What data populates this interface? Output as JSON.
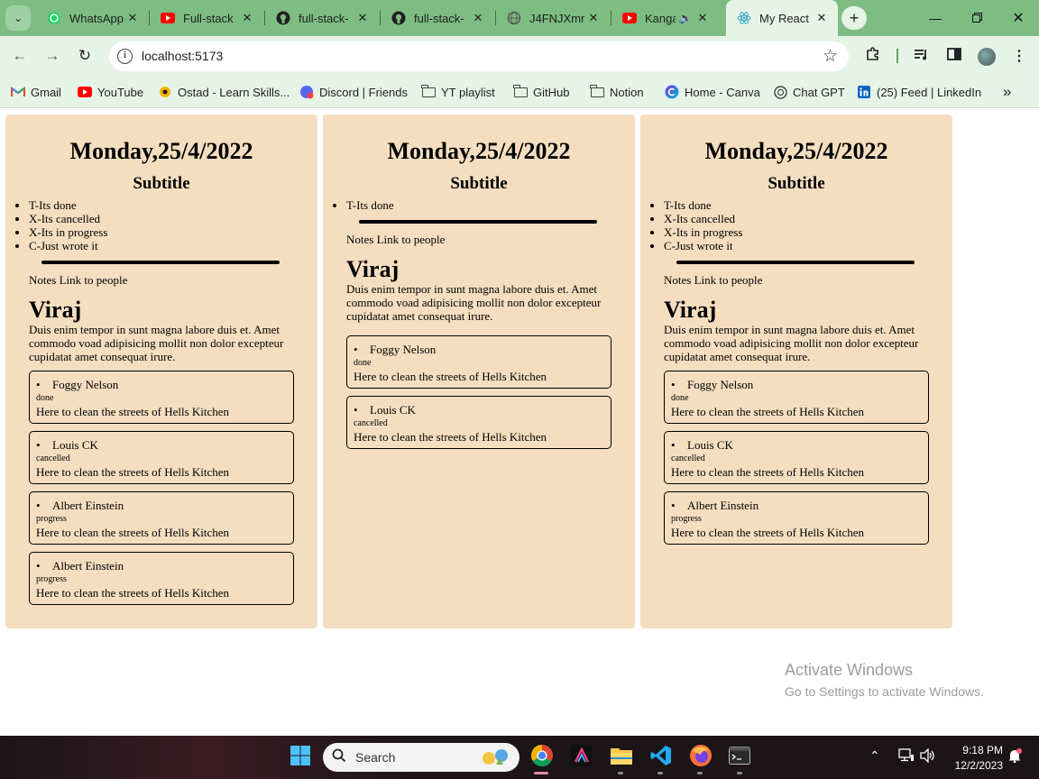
{
  "browser": {
    "tabs": [
      {
        "title": "WhatsApp",
        "icon": "whatsapp-icon",
        "active": false
      },
      {
        "title": "Full-stack",
        "icon": "youtube-icon",
        "active": false
      },
      {
        "title": "full-stack-",
        "icon": "github-icon",
        "active": false
      },
      {
        "title": "full-stack-",
        "icon": "github-icon",
        "active": false
      },
      {
        "title": "J4FNJXmr",
        "icon": "globe-icon",
        "active": false
      },
      {
        "title": "Kanga",
        "icon": "youtube-icon",
        "active": false
      },
      {
        "title": "My React",
        "icon": "react-icon",
        "active": true
      }
    ],
    "close_glyph": "✕",
    "url": "localhost:5173",
    "bookmarks": [
      {
        "label": "Gmail",
        "icon": "gmail-icon"
      },
      {
        "label": "YouTube",
        "icon": "youtube-icon"
      },
      {
        "label": "Ostad - Learn Skills...",
        "icon": "ostad-icon"
      },
      {
        "label": "Discord | Friends",
        "icon": "discord-icon"
      },
      {
        "label": "YT playlist",
        "icon": "folder-icon"
      },
      {
        "label": "GitHub",
        "icon": "folder-icon"
      },
      {
        "label": "Notion",
        "icon": "folder-icon"
      },
      {
        "label": "Home - Canva",
        "icon": "canva-icon"
      },
      {
        "label": "Chat GPT",
        "icon": "chatgpt-icon"
      },
      {
        "label": "(25) Feed | LinkedIn",
        "icon": "linkedin-icon"
      }
    ],
    "bookmarks_overflow": "»"
  },
  "cards": [
    {
      "date": "Monday,25/4/2022",
      "subtitle": "Subtitle",
      "statuses": [
        "T-Its done",
        "X-Its cancelled",
        "X-Its in progress",
        "C-Just wrote it"
      ],
      "notes": "Notes Link to people",
      "person": "Viraj",
      "description": "Duis enim tempor in sunt magna labore duis et. Amet commodo voad adipisicing mollit non dolor excepteur cupidatat amet consequat irure.",
      "people": [
        {
          "name": "Foggy Nelson",
          "status": "done",
          "text": "Here to clean the streets of Hells Kitchen"
        },
        {
          "name": "Louis CK",
          "status": "cancelled",
          "text": "Here to clean the streets of Hells Kitchen"
        },
        {
          "name": "Albert Einstein",
          "status": "progress",
          "text": "Here to clean the streets of Hells Kitchen"
        },
        {
          "name": "Albert Einstein",
          "status": "progress",
          "text": "Here to clean the streets of Hells Kitchen"
        }
      ]
    },
    {
      "date": "Monday,25/4/2022",
      "subtitle": "Subtitle",
      "statuses": [
        "T-Its done"
      ],
      "notes": "Notes Link to people",
      "person": "Viraj",
      "description": "Duis enim tempor in sunt magna labore duis et. Amet commodo voad adipisicing mollit non dolor excepteur cupidatat amet consequat irure.",
      "people": [
        {
          "name": "Foggy Nelson",
          "status": "done",
          "text": "Here to clean the streets of Hells Kitchen"
        },
        {
          "name": "Louis CK",
          "status": "cancelled",
          "text": "Here to clean the streets of Hells Kitchen"
        }
      ]
    },
    {
      "date": "Monday,25/4/2022",
      "subtitle": "Subtitle",
      "statuses": [
        "T-Its done",
        "X-Its cancelled",
        "X-Its in progress",
        "C-Just wrote it"
      ],
      "notes": "Notes Link to people",
      "person": "Viraj",
      "description": "Duis enim tempor in sunt magna labore duis et. Amet commodo voad adipisicing mollit non dolor excepteur cupidatat amet consequat irure.",
      "people": [
        {
          "name": "Foggy Nelson",
          "status": "done",
          "text": "Here to clean the streets of Hells Kitchen"
        },
        {
          "name": "Louis CK",
          "status": "cancelled",
          "text": "Here to clean the streets of Hells Kitchen"
        },
        {
          "name": "Albert Einstein",
          "status": "progress",
          "text": "Here to clean the streets of Hells Kitchen"
        }
      ]
    }
  ],
  "watermark": {
    "line1": "Activate Windows",
    "line2": "Go to Settings to activate Windows."
  },
  "taskbar": {
    "search_placeholder": "Search",
    "time": "9:18 PM",
    "date": "12/2/2023",
    "apps": [
      "chrome-icon",
      "adobe-icon",
      "file-explorer-icon",
      "vscode-icon",
      "firefox-icon",
      "terminal-icon"
    ]
  },
  "colors": {
    "tab_strip": "#7dbd82",
    "toolbar": "#e6f4e7",
    "card_bg": "#f5dec0",
    "taskbar": "#1b1517"
  }
}
